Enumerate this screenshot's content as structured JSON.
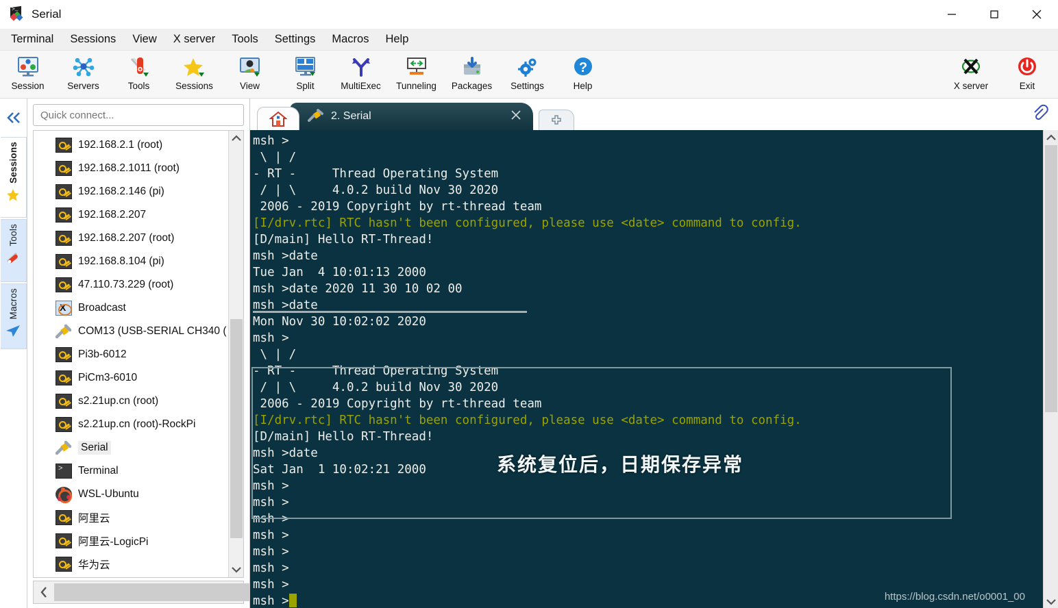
{
  "window": {
    "title": "Serial",
    "app_icon": "mobaxterm-icon",
    "controls": [
      {
        "name": "minimize-button",
        "glyph": "minimize-icon"
      },
      {
        "name": "maximize-button",
        "glyph": "maximize-icon"
      },
      {
        "name": "close-button",
        "glyph": "close-icon"
      }
    ]
  },
  "menubar": {
    "items": [
      {
        "label": "Terminal"
      },
      {
        "label": "Sessions"
      },
      {
        "label": "View"
      },
      {
        "label": "X server"
      },
      {
        "label": "Tools"
      },
      {
        "label": "Settings"
      },
      {
        "label": "Macros"
      },
      {
        "label": "Help"
      }
    ]
  },
  "toolbar": {
    "items": [
      {
        "label": "Session",
        "icon": "session-monitor-icon"
      },
      {
        "label": "Servers",
        "icon": "servers-network-icon"
      },
      {
        "label": "Tools",
        "icon": "swiss-knife-icon"
      },
      {
        "label": "Sessions",
        "icon": "star-icon"
      },
      {
        "label": "View",
        "icon": "view-user-monitor-icon"
      },
      {
        "label": "Split",
        "icon": "split-panes-icon"
      },
      {
        "label": "MultiExec",
        "icon": "multiexec-fork-icon"
      },
      {
        "label": "Tunneling",
        "icon": "tunneling-arrows-icon"
      },
      {
        "label": "Packages",
        "icon": "packages-download-icon"
      },
      {
        "label": "Settings",
        "icon": "gears-icon"
      },
      {
        "label": "Help",
        "icon": "help-question-icon"
      }
    ],
    "right_items": [
      {
        "label": "X server",
        "icon": "x-server-icon"
      },
      {
        "label": "Exit",
        "icon": "power-exit-icon"
      }
    ]
  },
  "rail": {
    "collapse_icon": "chevron-double-left-icon",
    "tabs": [
      {
        "label": "Sessions",
        "icon": "star-icon",
        "selected": true
      },
      {
        "label": "Tools",
        "icon": "swiss-knife-icon",
        "selected": false
      },
      {
        "label": "Macros",
        "icon": "paper-plane-icon",
        "selected": false
      }
    ]
  },
  "sidebar": {
    "quick_connect_placeholder": "Quick connect...",
    "sessions": [
      {
        "label": "192.168.2.1 (root)",
        "icon": "key-icon"
      },
      {
        "label": "192.168.2.1011 (root)",
        "icon": "key-icon"
      },
      {
        "label": "192.168.2.146 (pi)",
        "icon": "key-icon"
      },
      {
        "label": "192.168.2.207",
        "icon": "key-icon"
      },
      {
        "label": "192.168.2.207 (root)",
        "icon": "key-icon"
      },
      {
        "label": "192.168.8.104 (pi)",
        "icon": "key-icon"
      },
      {
        "label": "47.110.73.229 (root)",
        "icon": "key-icon"
      },
      {
        "label": "Broadcast",
        "icon": "broadcast-x-icon"
      },
      {
        "label": "COM13  (USB-SERIAL CH340 (",
        "icon": "serial-plug-icon"
      },
      {
        "label": "Pi3b-6012",
        "icon": "key-icon"
      },
      {
        "label": "PiCm3-6010",
        "icon": "key-icon"
      },
      {
        "label": "s2.21up.cn (root)",
        "icon": "key-icon"
      },
      {
        "label": "s2.21up.cn (root)-RockPi",
        "icon": "key-icon"
      },
      {
        "label": "Serial",
        "icon": "serial-plug-icon",
        "selected": true
      },
      {
        "label": "Terminal",
        "icon": "terminal-icon"
      },
      {
        "label": "WSL-Ubuntu",
        "icon": "ubuntu-icon"
      },
      {
        "label": "阿里云",
        "icon": "key-icon"
      },
      {
        "label": "阿里云-LogicPi",
        "icon": "key-icon"
      },
      {
        "label": "华为云",
        "icon": "key-icon"
      }
    ],
    "scroll_up_icon": "chevron-up-icon",
    "scroll_down_icon": "chevron-down-icon",
    "scroll_left_icon": "chevron-left-icon",
    "scroll_right_icon": "chevron-right-icon"
  },
  "tabs": {
    "home": {
      "name": "home-tab",
      "icon": "home-icon"
    },
    "active": {
      "label": "2. Serial",
      "icon": "serial-plug-icon",
      "close_icon": "close-icon"
    },
    "new": {
      "icon": "new-tab-plus-icon"
    },
    "clip_icon": "paperclip-icon"
  },
  "terminal": {
    "colors": {
      "background": "#0a3240",
      "foreground": "#e8e8d8",
      "log_green": "#9aa300",
      "cursor": "#9aa300"
    },
    "lines": [
      {
        "text": "msh >",
        "color": "white"
      },
      {
        "text": " \\ | /",
        "color": "white"
      },
      {
        "text": "- RT -     Thread Operating System",
        "color": "white"
      },
      {
        "text": " / | \\     4.0.2 build Nov 30 2020",
        "color": "white"
      },
      {
        "text": " 2006 - 2019 Copyright by rt-thread team",
        "color": "white"
      },
      {
        "text": "[I/drv.rtc] RTC hasn't been configured, please use <date> command to config.",
        "color": "green"
      },
      {
        "text": "[D/main] Hello RT-Thread!",
        "color": "white"
      },
      {
        "text": "msh >date",
        "color": "white"
      },
      {
        "text": "Tue Jan  4 10:01:13 2000",
        "color": "white"
      },
      {
        "text": "msh >date 2020 11 30 10 02 00",
        "color": "white"
      },
      {
        "text": "msh >date",
        "color": "white"
      },
      {
        "text": "Mon Nov 30 10:02:02 2020",
        "color": "white"
      },
      {
        "text": "msh >",
        "color": "white"
      },
      {
        "text": " \\ | /",
        "color": "white"
      },
      {
        "text": "- RT -     Thread Operating System",
        "color": "white"
      },
      {
        "text": " / | \\     4.0.2 build Nov 30 2020",
        "color": "white"
      },
      {
        "text": " 2006 - 2019 Copyright by rt-thread team",
        "color": "white"
      },
      {
        "text": "[I/drv.rtc] RTC hasn't been configured, please use <date> command to config.",
        "color": "green"
      },
      {
        "text": "[D/main] Hello RT-Thread!",
        "color": "white"
      },
      {
        "text": "msh >date",
        "color": "white"
      },
      {
        "text": "Sat Jan  1 10:02:21 2000",
        "color": "white"
      },
      {
        "text": "msh >",
        "color": "white"
      },
      {
        "text": "msh >",
        "color": "white"
      },
      {
        "text": "msh >",
        "color": "white"
      },
      {
        "text": "msh >",
        "color": "white"
      },
      {
        "text": "msh >",
        "color": "white"
      },
      {
        "text": "msh >",
        "color": "white"
      },
      {
        "text": "msh >",
        "color": "white"
      },
      {
        "text": "msh >",
        "color": "white",
        "cursor": true
      }
    ],
    "annotation": "系统复位后，日期保存异常",
    "watermark": "https://blog.csdn.net/o0001_00"
  }
}
